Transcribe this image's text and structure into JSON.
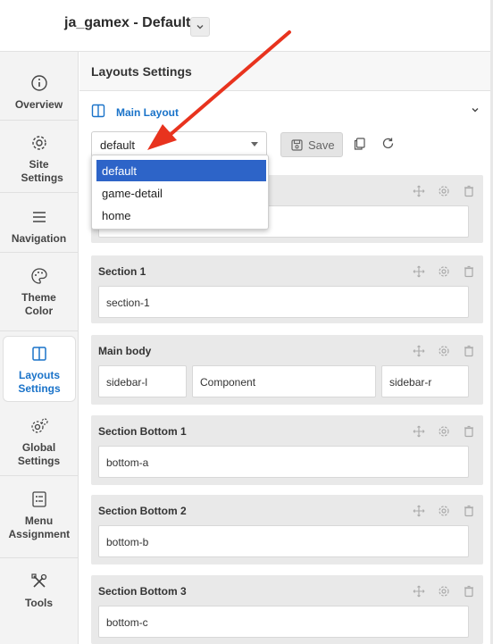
{
  "header": {
    "title": "ja_gamex - Default",
    "dropdown_icon": "chevron-down-icon"
  },
  "sidebar": {
    "items": [
      {
        "label": "Overview",
        "icon": "info-icon"
      },
      {
        "label": "Site Settings",
        "icon": "gear-icon"
      },
      {
        "label": "Navigation",
        "icon": "hamburger-icon"
      },
      {
        "label": "Theme Color",
        "icon": "palette-icon"
      },
      {
        "label": "Layouts Settings",
        "icon": "layout-icon",
        "active": true
      },
      {
        "label": "Global Settings",
        "icon": "gears-icon"
      },
      {
        "label": "Menu Assignment",
        "icon": "list-icon"
      },
      {
        "label": "Tools",
        "icon": "tools-icon"
      }
    ]
  },
  "main": {
    "title": "Layouts Settings",
    "layout_header": "Main Layout",
    "select": {
      "value": "default",
      "options": [
        "default",
        "game-detail",
        "home"
      ]
    },
    "save_label": "Save",
    "sections": [
      {
        "title": "",
        "positions": [
          ""
        ]
      },
      {
        "title": "Section 1",
        "positions": [
          "section-1"
        ]
      },
      {
        "title": "Main body",
        "positions": [
          "sidebar-l",
          "Component",
          "sidebar-r"
        ]
      },
      {
        "title": "Section Bottom 1",
        "positions": [
          "bottom-a"
        ]
      },
      {
        "title": "Section Bottom 2",
        "positions": [
          "bottom-b"
        ]
      },
      {
        "title": "Section Bottom 3",
        "positions": [
          "bottom-c"
        ]
      }
    ]
  },
  "colors": {
    "accent": "#1a73c9",
    "selected_option": "#2d64c8",
    "annotation_arrow": "#e8331e"
  }
}
